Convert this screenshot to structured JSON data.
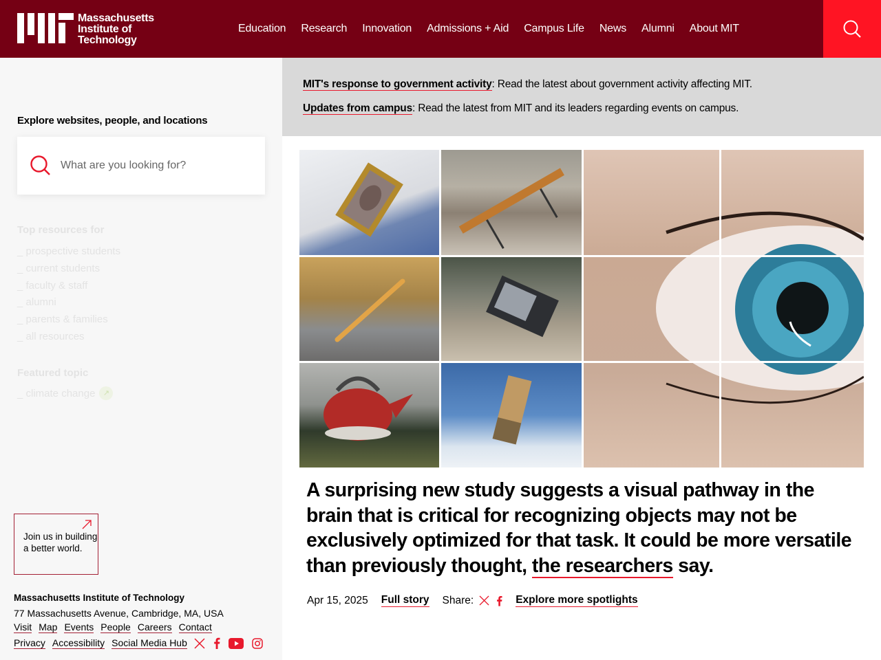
{
  "header": {
    "logo_lines": [
      "Massachusetts",
      "Institute of",
      "Technology"
    ],
    "nav": [
      "Education",
      "Research",
      "Innovation",
      "Admissions + Aid",
      "Campus Life",
      "News",
      "Alumni",
      "About MIT"
    ],
    "search_icon": "search-icon"
  },
  "announcements": [
    {
      "link": "MIT's response to government activity",
      "text": ": Read the latest about government activity affecting MIT."
    },
    {
      "link": "Updates from campus",
      "text": ": Read the latest from MIT and its leaders regarding events on campus."
    }
  ],
  "sidebar": {
    "explore_title": "Explore websites, people, and locations",
    "search_placeholder": "What are you looking for?",
    "resources_title": "Top resources for",
    "resources": [
      "prospective students",
      "current students",
      "faculty & staff",
      "alumni",
      "parents & families",
      "all resources"
    ],
    "featured_title": "Featured topic",
    "featured_item": "climate change",
    "join": "Join us in building a better world.",
    "footer": {
      "name": "Massachusetts Institute of Technology",
      "address": "77 Massachusetts Avenue, Cambridge, MA, USA",
      "links1": [
        "Visit",
        "Map",
        "Events",
        "People",
        "Careers",
        "Contact"
      ],
      "links2": [
        "Privacy",
        "Accessibility",
        "Social Media Hub"
      ],
      "social_icons": [
        "x-icon",
        "facebook-icon",
        "youtube-icon",
        "instagram-icon"
      ]
    }
  },
  "spotlight": {
    "headline_pre": "A surprising new study suggests a visual pathway in the brain that is critical for recognizing objects may not be exclusively optimized for that task. It could be more versatile than previously thought, ",
    "headline_link": "the researchers",
    "headline_post": " say.",
    "date": "Apr 15, 2025",
    "full_story": "Full story",
    "share_label": "Share:",
    "explore_more": "Explore more spotlights"
  },
  "colors": {
    "header_bg": "#750014",
    "search_bg": "#ff1423",
    "accent": "#a31f34"
  }
}
